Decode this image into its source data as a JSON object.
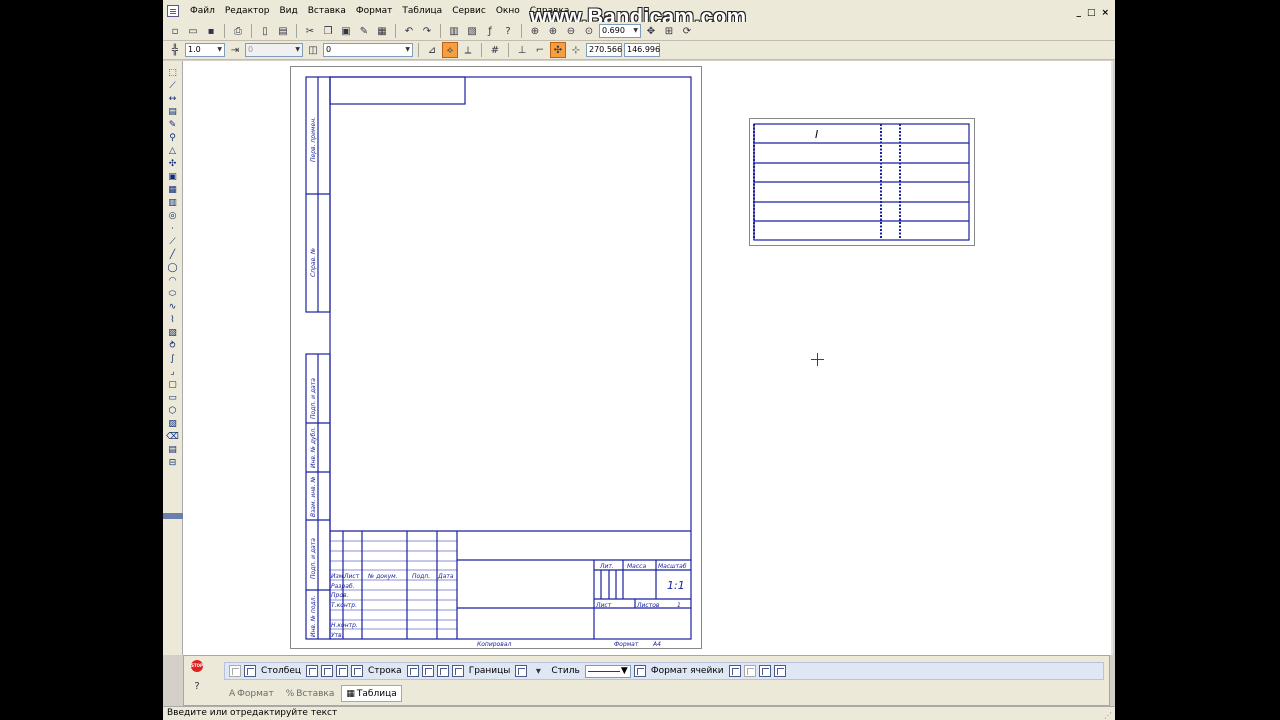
{
  "menubar": {
    "items": [
      "Файл",
      "Редактор",
      "Вид",
      "Вставка",
      "Формат",
      "Таблица",
      "Сервис",
      "Окно",
      "Справка"
    ],
    "window_controls": [
      "_",
      "□",
      "×"
    ]
  },
  "watermark": "www.Bandicam.com",
  "toolbar1": {
    "zoom_value": "0.690"
  },
  "toolbar2": {
    "line_scale": "1.0",
    "step_value": "0",
    "layer_value": "0",
    "coord_x": "270.566",
    "coord_y": "146.996"
  },
  "drawing_sheet": {
    "side_labels": [
      "Перв. примен.",
      "Справ. №",
      "Подп. и дата",
      "Инв. № дубл.",
      "Взам. инв. №",
      "Подп. и дата",
      "Инв. № подл."
    ],
    "title_block": {
      "column_headers": [
        "Изм.",
        "Лист",
        "№ докум.",
        "Подп.",
        "Дата"
      ],
      "row_labels": [
        "Разраб.",
        "Пров.",
        "Т.контр.",
        "Н.контр.",
        "Утв."
      ],
      "lit_label": "Лит.",
      "mass_label": "Масса",
      "scale_label": "Масштаб",
      "scale_value": "1:1",
      "sheet_label": "Лист",
      "sheets_label": "Листов",
      "sheets_value": "1",
      "copied_label": "Копировал",
      "format_label": "Формат",
      "format_value": "А4"
    }
  },
  "table_object": {
    "rows": 6,
    "first_cell_text": "I"
  },
  "properties_panel": {
    "columns_label": "Столбец",
    "row_label": "Строка",
    "borders_label": "Границы",
    "style_label": "Стиль",
    "cell_format_label": "Формат ячейки",
    "tabs": [
      {
        "label": "Формат",
        "active": false
      },
      {
        "label": "Вставка",
        "active": false
      },
      {
        "label": "Таблица",
        "active": true
      }
    ]
  },
  "statusbar": {
    "text": "Введите или отредактируйте текст"
  },
  "colors": {
    "drawing_line": "#1a22a0",
    "background": "#000000",
    "panel": "#ece9d8"
  }
}
